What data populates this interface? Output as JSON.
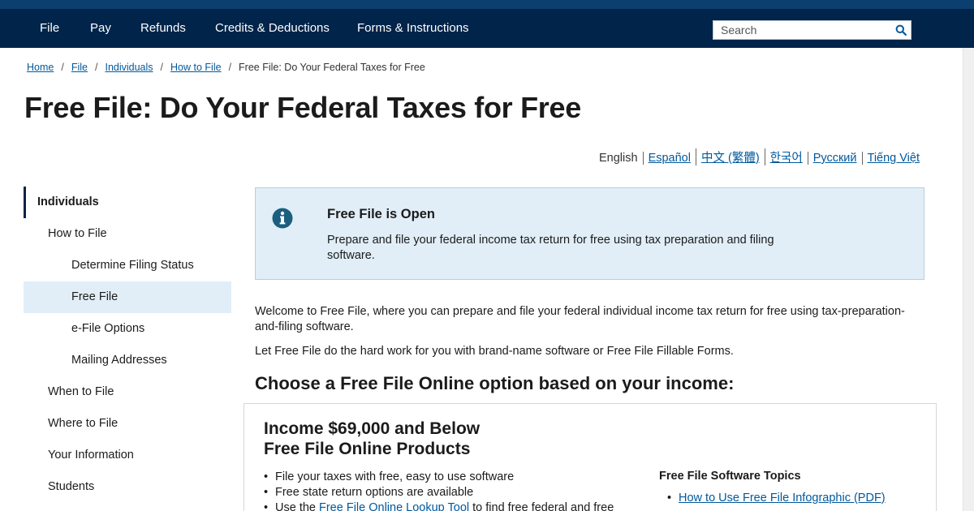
{
  "colors": {
    "top_strip": "#0b3f70",
    "nav_background": "#00244a",
    "link": "#00599c",
    "alert_background": "#e1eef7",
    "active_nav_background": "#e1eef7"
  },
  "nav": {
    "items": [
      "File",
      "Pay",
      "Refunds",
      "Credits & Deductions",
      "Forms & Instructions"
    ],
    "search_placeholder": "Search",
    "search_icon": "search-icon"
  },
  "breadcrumb": {
    "links": [
      "Home",
      "File",
      "Individuals",
      "How to File"
    ],
    "separator": "/",
    "current": "Free File: Do Your Federal Taxes for Free"
  },
  "page_title": "Free File: Do Your Federal Taxes for Free",
  "languages": {
    "current": "English",
    "links": [
      "Español",
      "中文 (繁體)",
      "한국어",
      "Русский",
      "Tiếng Việt"
    ]
  },
  "sidebar": {
    "root": "Individuals",
    "items": [
      {
        "label": "How to File",
        "level": 1,
        "active": false
      },
      {
        "label": "Determine Filing Status",
        "level": 2,
        "active": false
      },
      {
        "label": "Free File",
        "level": 2,
        "active": true
      },
      {
        "label": "e-File Options",
        "level": 2,
        "active": false
      },
      {
        "label": "Mailing Addresses",
        "level": 2,
        "active": false
      },
      {
        "label": "When to File",
        "level": 1,
        "active": false
      },
      {
        "label": "Where to File",
        "level": 1,
        "active": false
      },
      {
        "label": "Your Information",
        "level": 1,
        "active": false
      },
      {
        "label": "Students",
        "level": 1,
        "active": false
      }
    ]
  },
  "alert": {
    "icon": "info-icon",
    "title": "Free File is Open",
    "body": "Prepare and file your federal income tax return for free using tax preparation and filing software."
  },
  "main": {
    "intro": "Welcome to Free File, where you can prepare and file your federal individual income tax return for free using tax-preparation-and-filing software.",
    "intro2": "Let Free File do the hard work for you with brand-name software or Free File Fillable Forms.",
    "section_heading": "Choose a Free File Online option based on your income:"
  },
  "card": {
    "title_line1": "Income $69,000 and Below",
    "title_line2": "Free File Online Products",
    "bullets": [
      "File your taxes with free, easy to use software",
      "Free state return options are available"
    ],
    "bullet3_prefix": "Use the ",
    "bullet3_link": "Free File Online Lookup Tool",
    "bullet3_suffix": " to find free federal and free",
    "topics_title": "Free File Software Topics",
    "topics": [
      "How to Use Free File Infographic (PDF)"
    ]
  }
}
